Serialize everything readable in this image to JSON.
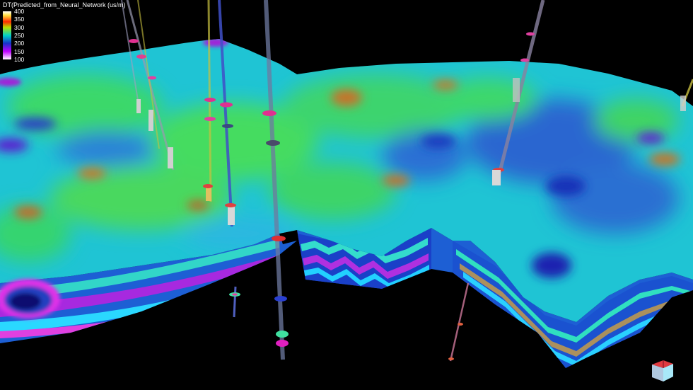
{
  "legend": {
    "title": "DT(Predicted_from_Neural_Network (us/m)",
    "ticks": [
      "400",
      "350",
      "300",
      "250",
      "200",
      "150",
      "100"
    ],
    "stops": [
      {
        "value": 400,
        "color": "#ffffff"
      },
      {
        "value": 375,
        "color": "#ffe040"
      },
      {
        "value": 335,
        "color": "#ff2a00"
      },
      {
        "value": 300,
        "color": "#b8e000"
      },
      {
        "value": 250,
        "color": "#00d2c8"
      },
      {
        "value": 200,
        "color": "#1830c8"
      },
      {
        "value": 150,
        "color": "#c000ff"
      },
      {
        "value": 100,
        "color": "#ffffff"
      }
    ]
  },
  "colors": {
    "background": "#000000",
    "surface_base": "#21c8d8",
    "surface_green": "#3ed36a",
    "surface_blue": "#2c5ad0",
    "surface_magenta": "#d020d8",
    "surface_orange": "#c8762a"
  },
  "orientation_cube": {
    "icon": "axis-orientation-cube-icon"
  }
}
